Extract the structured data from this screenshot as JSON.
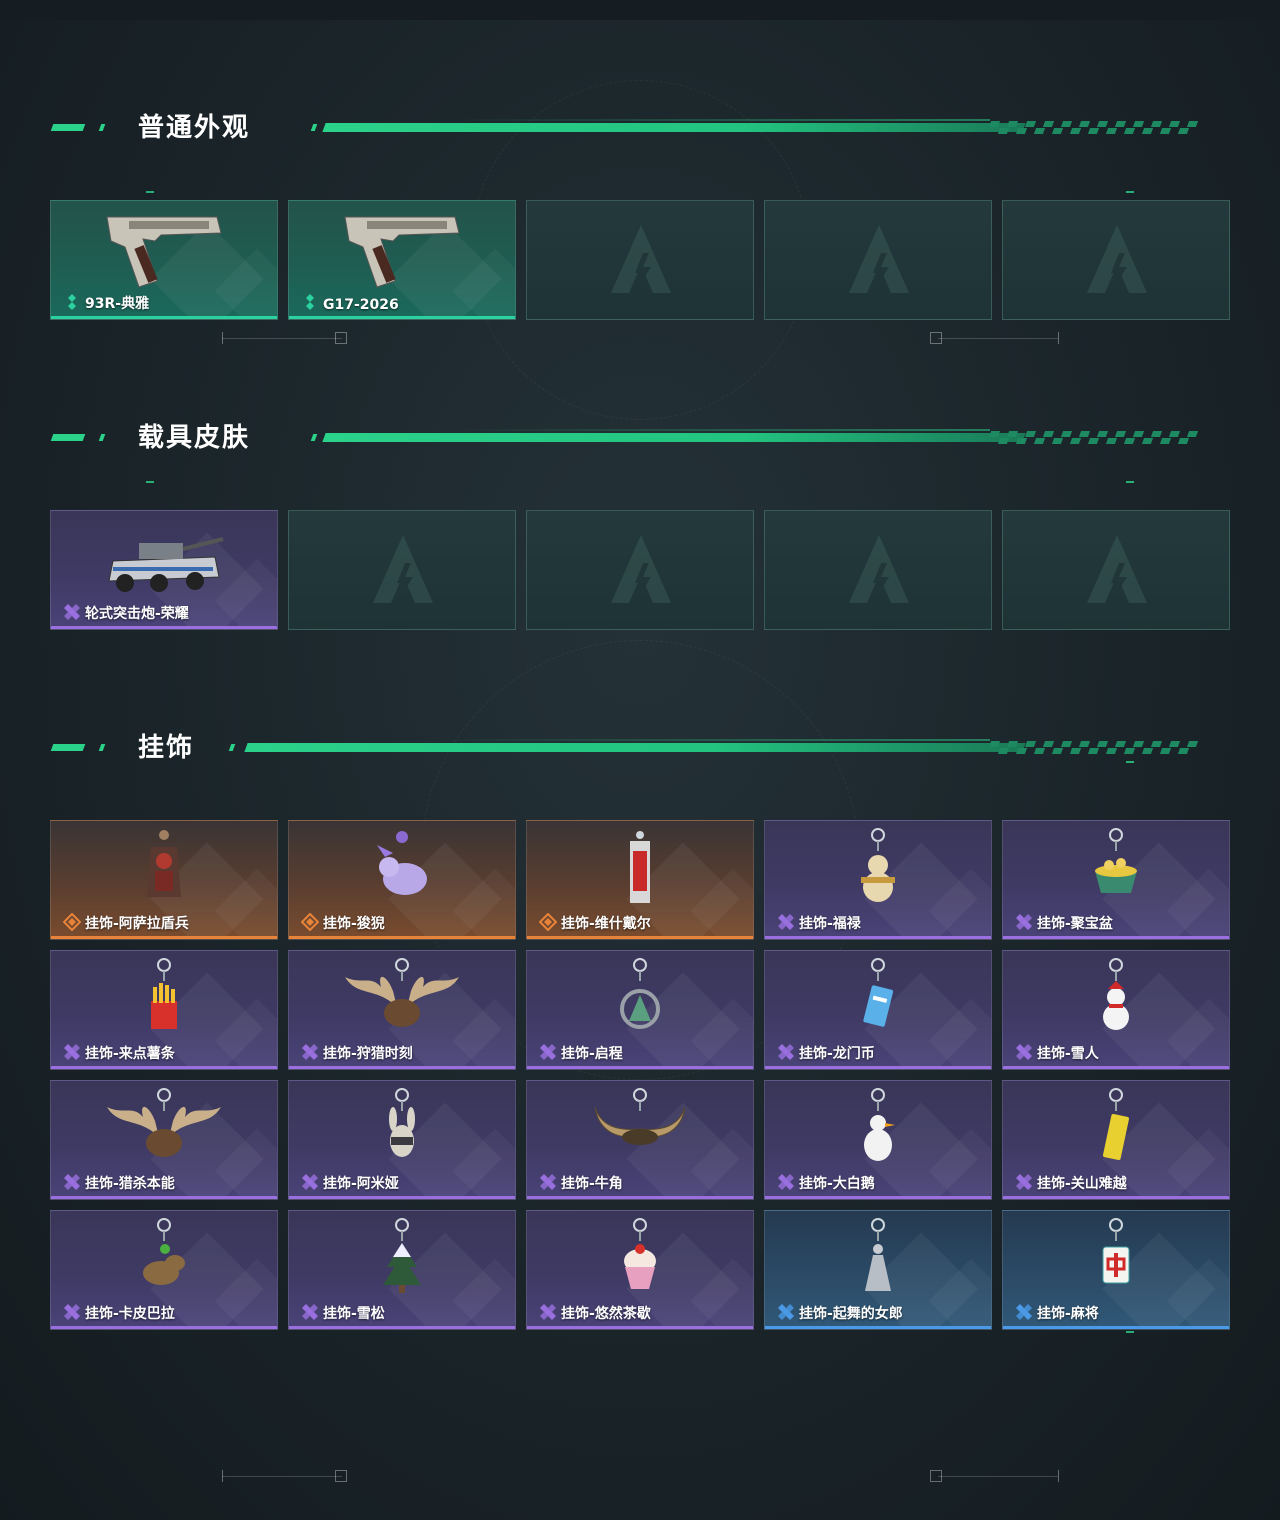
{
  "sections": [
    {
      "title": "普通外观",
      "items": [
        {
          "label": "93R-典雅",
          "rarity": "green",
          "icon": "pistol-icon"
        },
        {
          "label": "G17-2026",
          "rarity": "green",
          "icon": "pistol-icon"
        },
        {
          "label": "",
          "rarity": "empty",
          "icon": "placeholder-logo-icon"
        },
        {
          "label": "",
          "rarity": "empty",
          "icon": "placeholder-logo-icon"
        },
        {
          "label": "",
          "rarity": "empty",
          "icon": "placeholder-logo-icon"
        }
      ]
    },
    {
      "title": "载具皮肤",
      "items": [
        {
          "label": "轮式突击炮-荣耀",
          "rarity": "purple",
          "icon": "armored-vehicle-icon"
        },
        {
          "label": "",
          "rarity": "empty",
          "icon": "placeholder-logo-icon"
        },
        {
          "label": "",
          "rarity": "empty",
          "icon": "placeholder-logo-icon"
        },
        {
          "label": "",
          "rarity": "empty",
          "icon": "placeholder-logo-icon"
        },
        {
          "label": "",
          "rarity": "empty",
          "icon": "placeholder-logo-icon"
        }
      ]
    },
    {
      "title": "挂饰",
      "items": [
        {
          "label": "挂饰-阿萨拉盾兵",
          "rarity": "orange",
          "icon": "shield-soldier-charm-icon"
        },
        {
          "label": "挂饰-狻猊",
          "rarity": "orange",
          "icon": "lion-charm-icon"
        },
        {
          "label": "挂饰-维什戴尔",
          "rarity": "orange",
          "icon": "card-charm-icon"
        },
        {
          "label": "挂饰-福禄",
          "rarity": "purple",
          "icon": "gourd-charm-icon"
        },
        {
          "label": "挂饰-聚宝盆",
          "rarity": "purple",
          "icon": "treasure-bowl-charm-icon"
        },
        {
          "label": "挂饰-来点薯条",
          "rarity": "purple",
          "icon": "fries-charm-icon"
        },
        {
          "label": "挂饰-狩猎时刻",
          "rarity": "purple",
          "icon": "antler-charm-icon"
        },
        {
          "label": "挂饰-启程",
          "rarity": "purple",
          "icon": "emblem-charm-icon"
        },
        {
          "label": "挂饰-龙门币",
          "rarity": "purple",
          "icon": "coin-charm-icon"
        },
        {
          "label": "挂饰-雪人",
          "rarity": "purple",
          "icon": "snowman-charm-icon"
        },
        {
          "label": "挂饰-猎杀本能",
          "rarity": "purple",
          "icon": "antler-charm-icon"
        },
        {
          "label": "挂饰-阿米娅",
          "rarity": "purple",
          "icon": "rabbit-charm-icon"
        },
        {
          "label": "挂饰-牛角",
          "rarity": "purple",
          "icon": "horns-charm-icon"
        },
        {
          "label": "挂饰-大白鹅",
          "rarity": "purple",
          "icon": "goose-charm-icon"
        },
        {
          "label": "挂饰-关山难越",
          "rarity": "purple",
          "icon": "gold-bar-charm-icon"
        },
        {
          "label": "挂饰-卡皮巴拉",
          "rarity": "purple",
          "icon": "capybara-charm-icon"
        },
        {
          "label": "挂饰-雪松",
          "rarity": "purple",
          "icon": "pine-tree-charm-icon"
        },
        {
          "label": "挂饰-悠然茶歇",
          "rarity": "purple",
          "icon": "cupcake-charm-icon"
        },
        {
          "label": "挂饰-起舞的女郎",
          "rarity": "blue",
          "icon": "dancer-charm-icon"
        },
        {
          "label": "挂饰-麻将",
          "rarity": "blue",
          "icon": "mahjong-charm-icon"
        }
      ]
    }
  ],
  "colors": {
    "accent": "#2bd28a",
    "rarity_green": "#2bd2a0",
    "rarity_purple": "#9a70e0",
    "rarity_orange": "#e8843a",
    "rarity_blue": "#4a9ae8"
  }
}
